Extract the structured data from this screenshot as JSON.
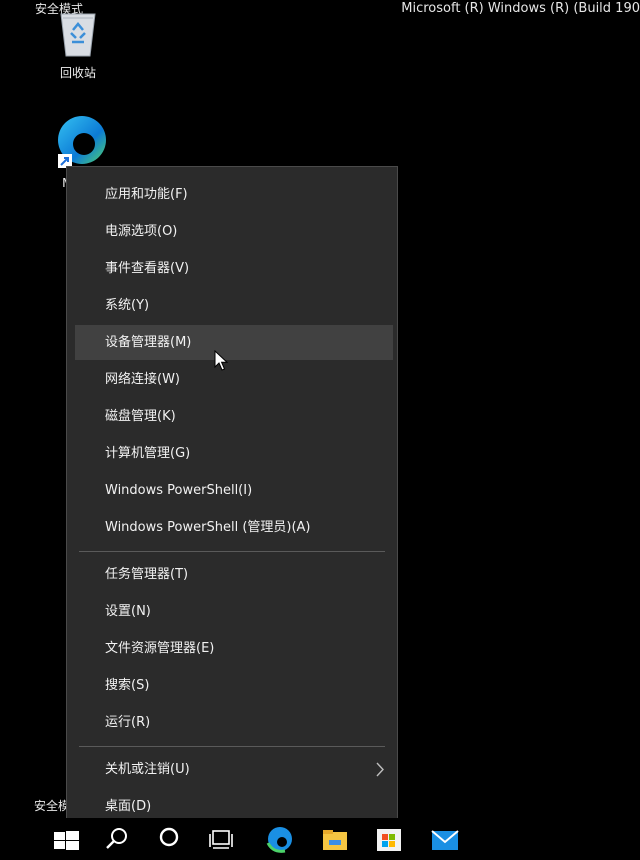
{
  "desktop": {
    "safe_mode_top": "安全模式",
    "safe_mode_bottom": "安全模",
    "build_info": "Microsoft (R) Windows (R) (Build 190",
    "icons": [
      {
        "label": "回收站",
        "icon": "recycle-bin-icon"
      },
      {
        "label": "Mic  E",
        "icon": "edge-icon"
      }
    ]
  },
  "menu": {
    "group1": [
      "应用和功能(F)",
      "电源选项(O)",
      "事件查看器(V)",
      "系统(Y)",
      "设备管理器(M)",
      "网络连接(W)",
      "磁盘管理(K)",
      "计算机管理(G)",
      "Windows PowerShell(I)",
      "Windows PowerShell (管理员)(A)"
    ],
    "group2": [
      "任务管理器(T)",
      "设置(N)",
      "文件资源管理器(E)",
      "搜索(S)",
      "运行(R)"
    ],
    "group3": [
      "关机或注销(U)",
      "桌面(D)"
    ],
    "hovered_item": "设备管理器(M)"
  },
  "taskbar": {
    "icons": [
      "windows-start-icon",
      "search-icon",
      "cortana-icon",
      "task-view-icon",
      "edge-icon",
      "file-explorer-icon",
      "store-icon",
      "mail-icon"
    ]
  },
  "colors": {
    "menu_bg": "#2b2b2b",
    "hover_bg": "#414141",
    "separator": "#5a5a5a",
    "text": "#f2f2f2"
  }
}
